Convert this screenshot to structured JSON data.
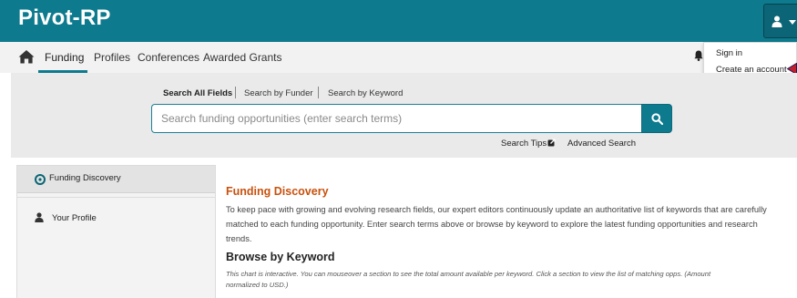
{
  "app": {
    "logo_text": "Pivot-RP"
  },
  "colors": {
    "brand": "#0e7a8e",
    "accent_title": "#c8510d",
    "pointer": "#c0202e"
  },
  "icons": {
    "home": "home-icon",
    "user": "user-icon",
    "bell": "bell-icon",
    "search": "search-icon",
    "external": "external-link-icon",
    "discovery": "compass-icon",
    "profile": "user-icon"
  },
  "nav": {
    "items": [
      {
        "label": "Funding",
        "active": true
      },
      {
        "label": "Profiles"
      },
      {
        "label": "Conferences"
      },
      {
        "label": "Awarded Grants"
      }
    ]
  },
  "account_menu": {
    "items": [
      {
        "label": "Sign in"
      },
      {
        "label": "Create an account"
      }
    ]
  },
  "search": {
    "tabs": [
      {
        "label": "Search All Fields",
        "active": true
      },
      {
        "label": "Search by Funder"
      },
      {
        "label": "Search by Keyword"
      }
    ],
    "placeholder": "Search funding opportunities (enter search terms)",
    "links": {
      "tips": "Search Tips",
      "advanced": "Advanced Search"
    }
  },
  "sidebar": {
    "items": [
      {
        "label": "Funding Discovery",
        "active": true
      },
      {
        "label": "Your Profile"
      }
    ]
  },
  "main": {
    "title": "Funding Discovery",
    "intro": "To keep pace with growing and evolving research fields, our expert editors continuously update an authoritative list of keywords that are carefully matched to each funding opportunity. Enter search terms above or browse by keyword to explore the latest funding opportunities and research trends.",
    "browse_title": "Browse by Keyword",
    "chart_note": "This chart is interactive. You can mouseover a section to see the total amount available per keyword. Click a section to view the list of matching opps. (Amount normalized to USD.)"
  }
}
